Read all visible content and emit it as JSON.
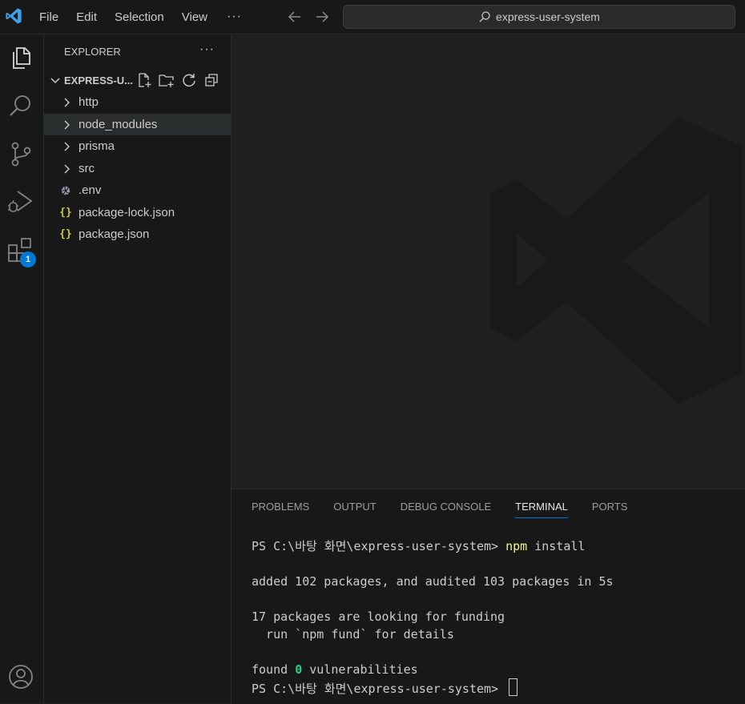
{
  "titlebar": {
    "menu": [
      "File",
      "Edit",
      "Selection",
      "View"
    ],
    "more": "···",
    "search_text": "express-user-system"
  },
  "activitybar": {
    "items": [
      "explorer-icon",
      "search-icon",
      "source-control-icon",
      "run-debug-icon",
      "extensions-icon",
      "account-icon"
    ],
    "extensions_badge": "1"
  },
  "sidebar": {
    "title": "EXPLORER",
    "more": "···",
    "folder": "EXPRESS-U...",
    "items": [
      {
        "label": "http",
        "kind": "folder"
      },
      {
        "label": "node_modules",
        "kind": "folder"
      },
      {
        "label": "prisma",
        "kind": "folder"
      },
      {
        "label": "src",
        "kind": "folder"
      },
      {
        "label": ".env",
        "kind": "gear"
      },
      {
        "label": "package-lock.json",
        "kind": "json"
      },
      {
        "label": "package.json",
        "kind": "json"
      }
    ]
  },
  "panel": {
    "tabs": [
      "PROBLEMS",
      "OUTPUT",
      "DEBUG CONSOLE",
      "TERMINAL",
      "PORTS"
    ],
    "active_tab": "TERMINAL",
    "terminal": {
      "prompt": "PS C:\\바탕 화면\\express-user-system> ",
      "cmd": "npm",
      "cmd_args": " install",
      "line_added": "added 102 packages, and audited 103 packages in 5s",
      "line_funding": "17 packages are looking for funding",
      "line_fund": "  run `npm fund` for details",
      "found_pre": "found ",
      "found_zero": "0",
      "found_post": " vulnerabilities"
    }
  },
  "colors": {
    "accent": "#0078d4",
    "json_braces": "#cbcb41",
    "terminal_cmd": "#f1fa8c",
    "terminal_zero": "#23d18b"
  }
}
